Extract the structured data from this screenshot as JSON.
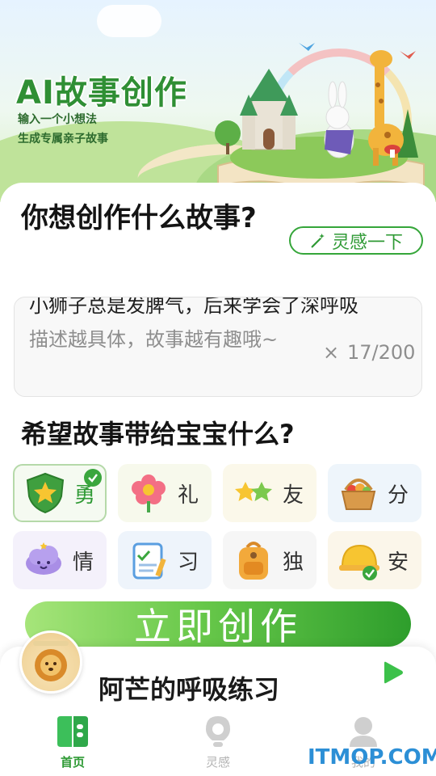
{
  "banner": {
    "title": "AI故事创作",
    "subtitle_line1": "输入一个小想法",
    "subtitle_line2": "生成专属亲子故事"
  },
  "question1": {
    "title": "你想创作什么故事?",
    "inspiration_button": "灵感一下",
    "input_value": "小狮子总是发脾气，后来学会了深呼吸",
    "input_placeholder": "描述越具体，故事越有趣哦~",
    "counter": "17/200",
    "clear_icon": "×"
  },
  "question2": {
    "title": "希望故事带给宝宝什么?",
    "options": [
      {
        "label": "勇",
        "icon": "shield-star-icon",
        "selected": true
      },
      {
        "label": "礼",
        "icon": "flower-icon",
        "selected": false
      },
      {
        "label": "友",
        "icon": "two-stars-icon",
        "selected": false
      },
      {
        "label": "分",
        "icon": "fruit-basket-icon",
        "selected": false
      },
      {
        "label": "情",
        "icon": "cloud-face-icon",
        "selected": false
      },
      {
        "label": "习",
        "icon": "checklist-icon",
        "selected": false
      },
      {
        "label": "独",
        "icon": "backpack-icon",
        "selected": false
      },
      {
        "label": "安",
        "icon": "helmet-icon",
        "selected": false
      }
    ]
  },
  "create_button": "立即创作",
  "player": {
    "title": "阿芒的呼吸练习"
  },
  "tabs": [
    {
      "label": "首页",
      "icon": "home-book-icon",
      "active": true
    },
    {
      "label": "灵感",
      "icon": "bulb-icon",
      "active": false
    },
    {
      "label": "我的",
      "icon": "profile-icon",
      "active": false
    }
  ],
  "watermark": "ITMOP.COM",
  "colors": {
    "accent": "#2f9a35",
    "selected_border": "#b5d9a9",
    "create_gradient_start": "#a6e57a",
    "create_gradient_end": "#2e9e2c"
  }
}
